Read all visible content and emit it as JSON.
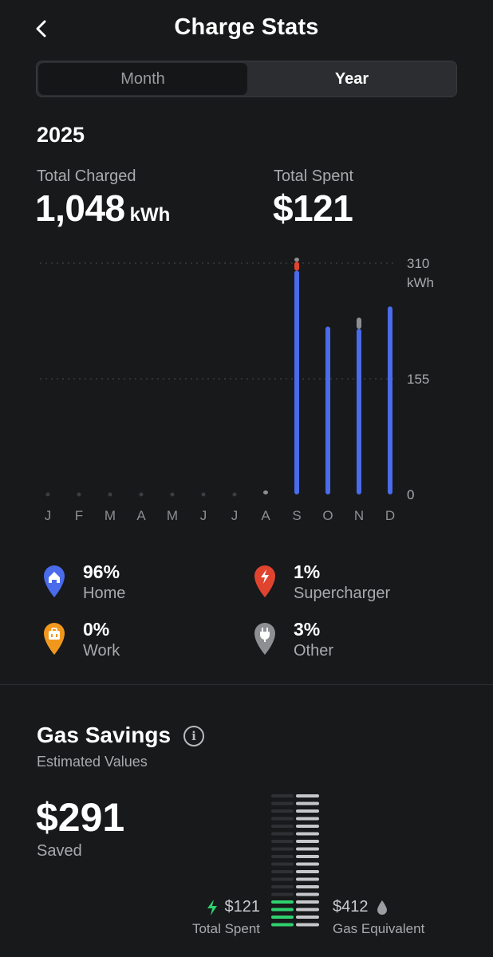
{
  "header": {
    "title": "Charge Stats",
    "back_icon": "chevron-left-icon"
  },
  "segment": {
    "tabs": [
      {
        "label": "Month",
        "selected": false
      },
      {
        "label": "Year",
        "selected": true
      }
    ]
  },
  "year": "2025",
  "totals": {
    "charged_label": "Total Charged",
    "charged_value": "1,048",
    "charged_unit": "kWh",
    "spent_label": "Total Spent",
    "spent_value": "$121"
  },
  "chart_data": {
    "type": "bar",
    "categories": [
      "J",
      "F",
      "M",
      "A",
      "M",
      "J",
      "J",
      "A",
      "S",
      "O",
      "N",
      "D"
    ],
    "series": [
      {
        "name": "Home",
        "color": "#4a6bea",
        "values": [
          0,
          0,
          0,
          0,
          0,
          0,
          0,
          0,
          300,
          225,
          222,
          252
        ]
      },
      {
        "name": "Supercharger",
        "color": "#e0442f",
        "values": [
          0,
          0,
          0,
          0,
          0,
          0,
          0,
          0,
          12,
          0,
          0,
          0
        ]
      },
      {
        "name": "Other",
        "color": "#8e8f92",
        "values": [
          0,
          0,
          0,
          0,
          0,
          0,
          0,
          4,
          4,
          0,
          15,
          0
        ]
      }
    ],
    "ylim": [
      0,
      310
    ],
    "yticks": [
      "0",
      "155",
      "310"
    ],
    "yunit": "kWh",
    "grid": true
  },
  "legend": [
    {
      "pct": "96%",
      "name": "Home",
      "color": "#4a6bea",
      "icon": "home-icon"
    },
    {
      "pct": "1%",
      "name": "Supercharger",
      "color": "#e0442f",
      "icon": "lightning-icon"
    },
    {
      "pct": "0%",
      "name": "Work",
      "color": "#f0981e",
      "icon": "briefcase-icon"
    },
    {
      "pct": "3%",
      "name": "Other",
      "color": "#8e8f92",
      "icon": "plug-icon"
    }
  ],
  "gas_savings": {
    "title": "Gas Savings",
    "subtitle": "Estimated Values",
    "saved_value": "$291",
    "saved_label": "Saved",
    "spent_amount": "$121",
    "spent_label": "Total Spent",
    "gas_amount": "$412",
    "gas_label": "Gas Equivalent",
    "spent_fraction": 0.29,
    "colors": {
      "spent": "#2fd16f",
      "gas": "#c6c7ca"
    }
  }
}
